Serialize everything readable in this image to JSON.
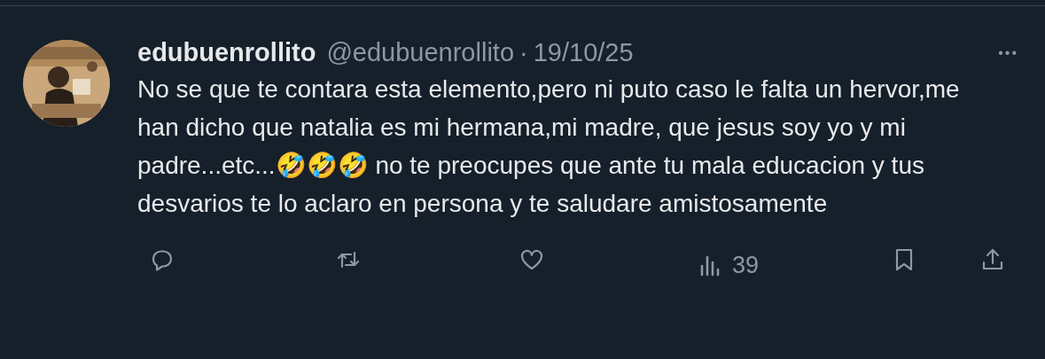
{
  "post": {
    "display_name": "edubuenrollito",
    "handle": "@edubuenrollito",
    "separator": "·",
    "date": "19/10/25",
    "more": "•••",
    "text": "No se que te contara esta elemento,pero ni puto caso le falta un hervor,me han dicho que natalia es mi hermana,mi madre, que jesus soy yo y mi padre...etc...🤣🤣🤣 no te preocupes que ante tu mala educacion y tus desvarios te lo aclaro en persona y te saludare amistosamente"
  },
  "actions": [
    {
      "kind": "reply"
    },
    {
      "kind": "repost"
    },
    {
      "kind": "like"
    },
    {
      "kind": "views",
      "count": "39"
    },
    {
      "kind": "bookmark"
    },
    {
      "kind": "share"
    }
  ]
}
